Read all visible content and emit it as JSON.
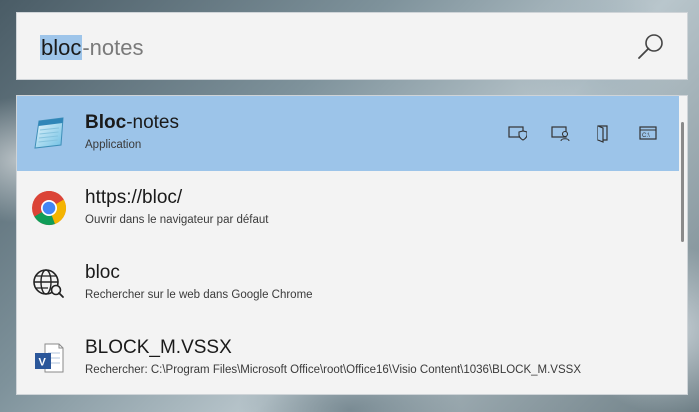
{
  "search": {
    "typed": "bloc",
    "suggestion": "-notes",
    "icon": "search-icon"
  },
  "results": [
    {
      "title_bold": "Bloc",
      "title_rest": "-notes",
      "subtitle": "Application",
      "icon": "notepad-icon",
      "selected": true,
      "context_actions": [
        "run-as-admin-icon",
        "run-as-user-icon",
        "open-folder-icon",
        "open-console-icon"
      ]
    },
    {
      "title_bold": "",
      "title_rest": "https://bloc/",
      "subtitle": "Ouvrir dans le navigateur par défaut",
      "icon": "chrome-icon",
      "selected": false
    },
    {
      "title_bold": "",
      "title_rest": "bloc",
      "subtitle": "Rechercher sur le web dans Google Chrome",
      "icon": "web-search-icon",
      "selected": false
    },
    {
      "title_bold": "",
      "title_rest": "BLOCK_M.VSSX",
      "subtitle": "Rechercher: C:\\Program Files\\Microsoft Office\\root\\Office16\\Visio Content\\1036\\BLOCK_M.VSSX",
      "icon": "visio-file-icon",
      "selected": false
    }
  ],
  "colors": {
    "selection": "#9cc4e9",
    "panel": "#f3f3f3",
    "highlight": "#9ec5ea"
  }
}
